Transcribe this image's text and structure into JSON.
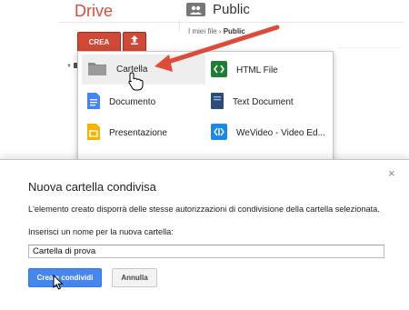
{
  "app": {
    "brand": "Drive"
  },
  "folder": {
    "title": "Public",
    "icon": "people-icon"
  },
  "breadcrumb": {
    "parent": "I miei file",
    "separator": "›",
    "current": "Public"
  },
  "toolbar": {
    "create_label": "CREA",
    "upload_icon": "upload-icon"
  },
  "menu": {
    "items": [
      {
        "label": "Cartella",
        "icon": "folder-icon",
        "color": "#8a8a8a"
      },
      {
        "label": "HTML File",
        "icon": "html-file-icon",
        "color": "#1e7e34"
      },
      {
        "label": "Documento",
        "icon": "document-icon",
        "color": "#4285f4"
      },
      {
        "label": "Text Document",
        "icon": "text-document-icon",
        "color": "#2a4d7a"
      },
      {
        "label": "Presentazione",
        "icon": "presentation-icon",
        "color": "#f4b400"
      },
      {
        "label": "WeVideo - Video Ed...",
        "icon": "wevideo-icon",
        "color": "#1e88e5"
      }
    ]
  },
  "dialog": {
    "title": "Nuova cartella condivisa",
    "description": "L'elemento creato disporrà delle stesse autorizzazioni di condivisione della cartella selezionata.",
    "prompt": "Inserisci un nome per la nuova cartella:",
    "input_value": "Cartella di prova",
    "primary_label": "Crea e condividi",
    "secondary_label": "Annulla",
    "close_symbol": "×"
  },
  "annotation": {
    "arrow_color": "#dd4b39"
  }
}
